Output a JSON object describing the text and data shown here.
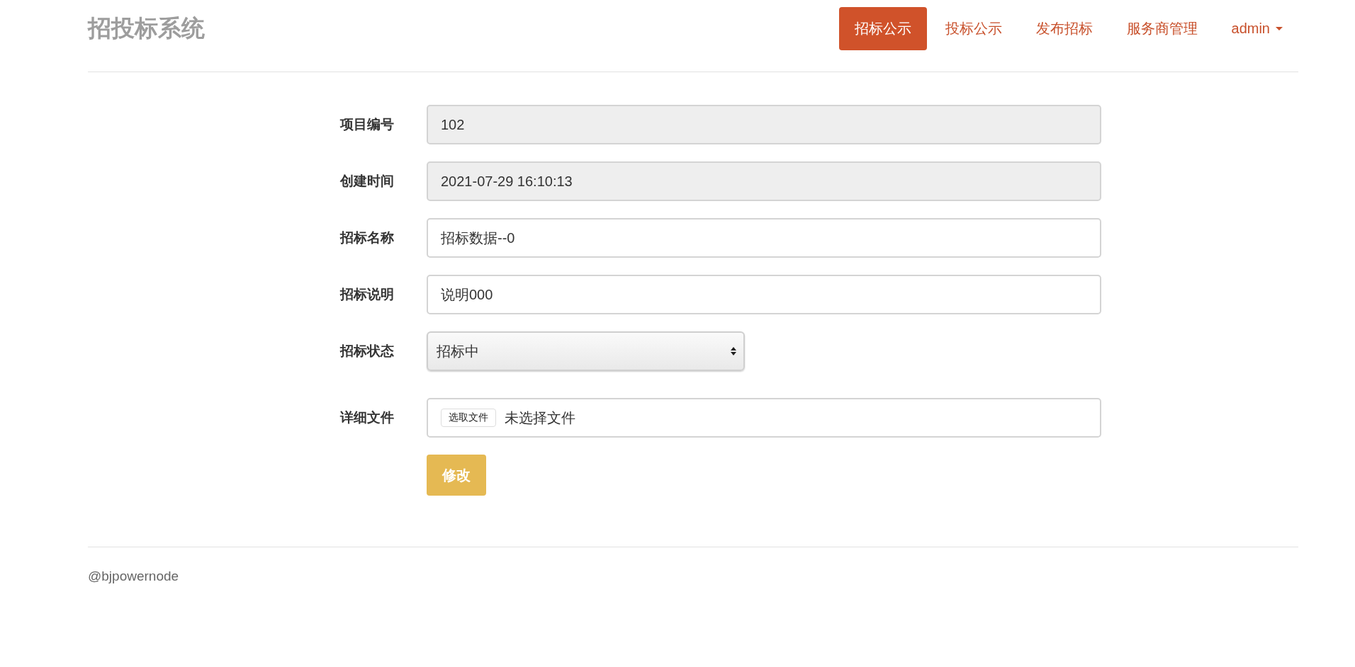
{
  "brand": "招投标系统",
  "nav": [
    {
      "label": "招标公示",
      "selected": true
    },
    {
      "label": "投标公示",
      "selected": false
    },
    {
      "label": "发布招标",
      "selected": false
    },
    {
      "label": "服务商管理",
      "selected": false
    },
    {
      "label": "admin",
      "selected": false,
      "kind": "dropdown"
    }
  ],
  "form": [
    {
      "label": "项目编号",
      "kind": "text",
      "value": "102",
      "disabled": true
    },
    {
      "label": "创建时间",
      "kind": "text",
      "value": "2021-07-29 16:10:13",
      "disabled": true
    },
    {
      "label": "招标名称",
      "kind": "text",
      "value": "招标数据--0",
      "disabled": false
    },
    {
      "label": "招标说明",
      "kind": "text",
      "value": "说明000",
      "disabled": false
    },
    {
      "label": "招标状态",
      "kind": "select",
      "value": "招标中"
    },
    {
      "label": "详细文件",
      "kind": "file",
      "button": "选取文件",
      "value": "未选择文件"
    }
  ],
  "submit": "修改",
  "footer": "@bjpowernode"
}
